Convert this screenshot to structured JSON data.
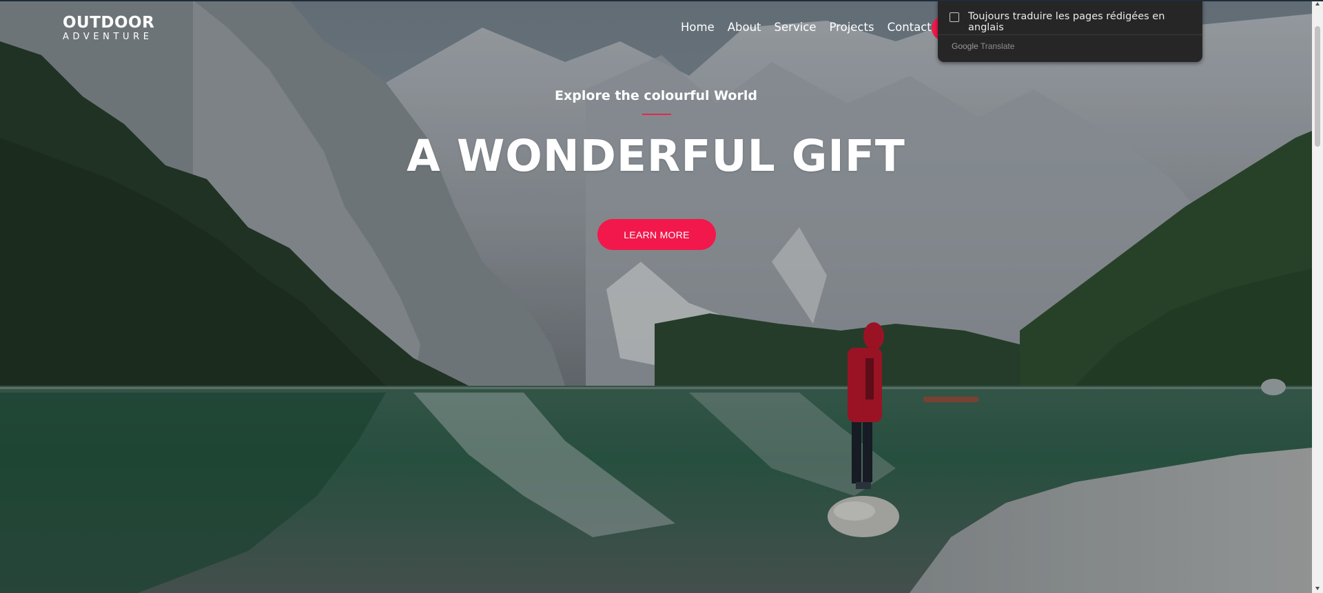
{
  "logo": {
    "title": "OUTDOOR",
    "subtitle": "ADVENTURE"
  },
  "nav": {
    "items": [
      "Home",
      "About",
      "Service",
      "Projects",
      "Contact"
    ]
  },
  "hero": {
    "eyebrow": "Explore the colourful World",
    "headline": "A WONDERFUL GIFT",
    "cta_label": "LEARN MORE"
  },
  "translate_popup": {
    "checkbox_label": "Toujours traduire les pages rédigées en anglais",
    "brand": "Google",
    "product": "Translate",
    "checked": false
  },
  "colors": {
    "accent": "#f2184b",
    "text": "#ffffff",
    "popup_bg": "#262626"
  },
  "icons": {
    "checkbox": "checkbox-icon",
    "scroll_up": "arrow-up-icon",
    "scroll_down": "arrow-down-icon"
  }
}
